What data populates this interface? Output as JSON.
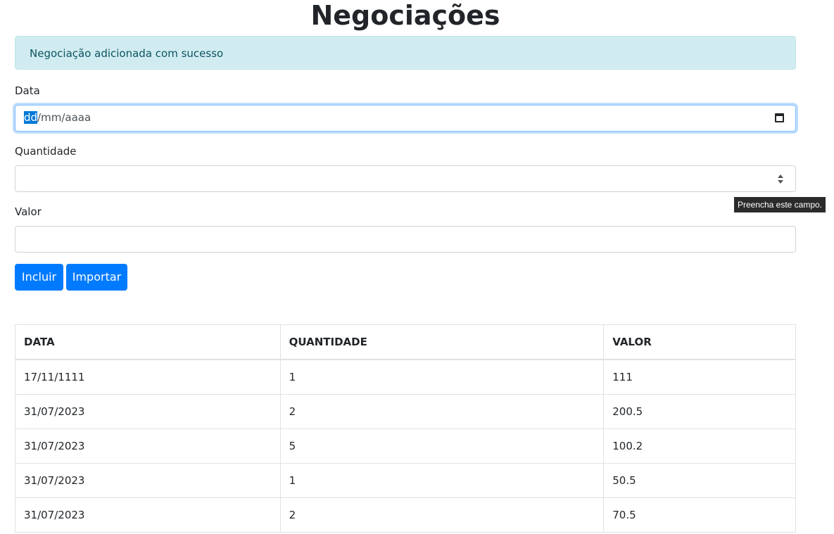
{
  "page": {
    "title": "Negociações"
  },
  "alert": {
    "message": "Negociação adicionada com sucesso"
  },
  "form": {
    "data_label": "Data",
    "data_value_selected": "dd",
    "data_value_rest": "/mm/aaaa",
    "quantidade_label": "Quantidade",
    "quantidade_value": "",
    "valor_label": "Valor",
    "valor_value": "",
    "tooltip": "Preencha este campo."
  },
  "buttons": {
    "incluir": "Incluir",
    "importar": "Importar"
  },
  "table": {
    "headers": [
      "DATA",
      "QUANTIDADE",
      "VALOR"
    ],
    "rows": [
      [
        "17/11/1111",
        "1",
        "111"
      ],
      [
        "31/07/2023",
        "2",
        "200.5"
      ],
      [
        "31/07/2023",
        "5",
        "100.2"
      ],
      [
        "31/07/2023",
        "1",
        "50.5"
      ],
      [
        "31/07/2023",
        "2",
        "70.5"
      ]
    ]
  },
  "colors": {
    "primary": "#007bff",
    "alert_bg": "#d1ecf1",
    "alert_text": "#0c5460",
    "selection": "#0078d7"
  },
  "icons": {
    "date_picker": "calendar-icon",
    "number_spinner": "spinner-icon"
  }
}
